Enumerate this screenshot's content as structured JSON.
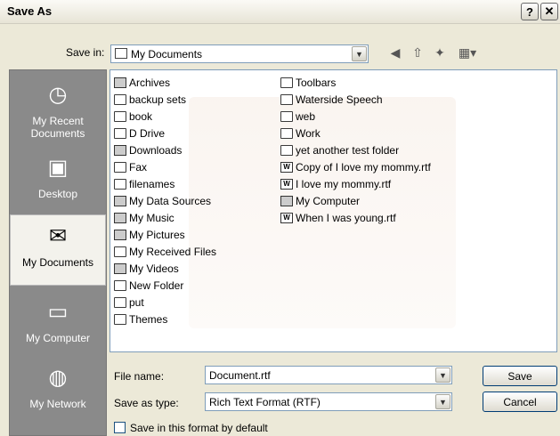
{
  "dialog": {
    "title": "Save As"
  },
  "titlebar": {
    "help_label": "?",
    "close_label": "✕"
  },
  "save_in": {
    "label": "Save in:",
    "value": "My Documents"
  },
  "places": [
    {
      "name": "recent",
      "label": "My Recent Documents",
      "icon": "recent-documents-icon"
    },
    {
      "name": "desktop",
      "label": "Desktop",
      "icon": "desktop-icon"
    },
    {
      "name": "my-documents",
      "label": "My Documents",
      "icon": "my-documents-icon"
    },
    {
      "name": "my-computer",
      "label": "My Computer",
      "icon": "my-computer-icon"
    },
    {
      "name": "my-network",
      "label": "My Network",
      "icon": "my-network-icon"
    }
  ],
  "files_col1": [
    {
      "name": "Archives",
      "type": "special"
    },
    {
      "name": "backup sets",
      "type": "folder"
    },
    {
      "name": "book",
      "type": "folder"
    },
    {
      "name": "D Drive",
      "type": "folder"
    },
    {
      "name": "Downloads",
      "type": "special"
    },
    {
      "name": "Fax",
      "type": "folder"
    },
    {
      "name": "filenames",
      "type": "folder"
    },
    {
      "name": "My Data Sources",
      "type": "special"
    },
    {
      "name": "My Music",
      "type": "special"
    },
    {
      "name": "My Pictures",
      "type": "special"
    },
    {
      "name": "My Received Files",
      "type": "folder"
    },
    {
      "name": "My Videos",
      "type": "special"
    },
    {
      "name": "New Folder",
      "type": "folder"
    },
    {
      "name": "put",
      "type": "folder"
    },
    {
      "name": "Themes",
      "type": "folder"
    }
  ],
  "files_col2": [
    {
      "name": "Toolbars",
      "type": "folder"
    },
    {
      "name": "Waterside Speech",
      "type": "folder"
    },
    {
      "name": "web",
      "type": "folder"
    },
    {
      "name": "Work",
      "type": "folder"
    },
    {
      "name": "yet another test folder",
      "type": "folder"
    },
    {
      "name": "Copy of I love my mommy.rtf",
      "type": "doc"
    },
    {
      "name": "I love my mommy.rtf",
      "type": "doc"
    },
    {
      "name": "My Computer",
      "type": "special"
    },
    {
      "name": "When I was young.rtf",
      "type": "doc"
    }
  ],
  "file_name": {
    "label": "File name:",
    "value": "Document.rtf"
  },
  "save_as_type": {
    "label": "Save as type:",
    "value": "Rich Text Format (RTF)"
  },
  "buttons": {
    "save": "Save",
    "cancel": "Cancel"
  },
  "checkbox": {
    "label": "Save in this format by default",
    "checked": false
  }
}
